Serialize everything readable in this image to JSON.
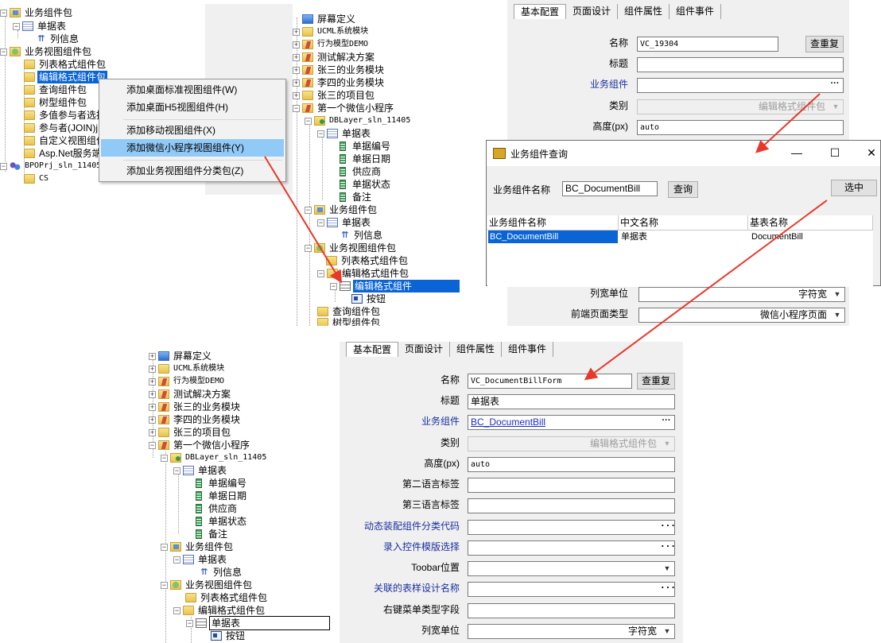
{
  "top_left_tree": {
    "items": [
      {
        "label": "业务组件包"
      },
      {
        "label": "单据表"
      },
      {
        "label": "列信息"
      },
      {
        "label": "业务视图组件包"
      },
      {
        "label": "列表格式组件包"
      },
      {
        "label": "编辑格式组件包"
      },
      {
        "label": "查询组件包"
      },
      {
        "label": "树型组件包"
      },
      {
        "label": "多值参与者选择"
      },
      {
        "label": "参与者(JOIN)j"
      },
      {
        "label": "自定义视图组件"
      },
      {
        "label": "Asp.Net服务端"
      },
      {
        "label": "BPOPrj_sln_11405"
      },
      {
        "label": "CS"
      }
    ]
  },
  "context_menu": {
    "items": [
      {
        "label": "添加桌面标准视图组件(W)"
      },
      {
        "label": "添加桌面H5视图组件(H)"
      },
      {
        "label": "添加移动视图组件(X)"
      },
      {
        "label": "添加微信小程序视图组件(Y)"
      },
      {
        "label": "添加业务视图组件分类包(Z)"
      }
    ]
  },
  "top_mid_tree": {
    "items": [
      {
        "label": "屏幕定义"
      },
      {
        "label": "UCML系统模块"
      },
      {
        "label": "行为模型DEMO"
      },
      {
        "label": "测试解决方案"
      },
      {
        "label": "张三的业务模块"
      },
      {
        "label": "李四的业务模块"
      },
      {
        "label": "张三的项目包"
      },
      {
        "label": "第一个微信小程序"
      },
      {
        "label": "DBLayer_sln_11405"
      },
      {
        "label": "单据表"
      },
      {
        "label": "单据编号"
      },
      {
        "label": "单据日期"
      },
      {
        "label": "供应商"
      },
      {
        "label": "单据状态"
      },
      {
        "label": "备注"
      },
      {
        "label": "业务组件包"
      },
      {
        "label": "单据表"
      },
      {
        "label": "列信息"
      },
      {
        "label": "业务视图组件包"
      },
      {
        "label": "列表格式组件包"
      },
      {
        "label": "编辑格式组件包"
      },
      {
        "label": "编辑格式组件"
      },
      {
        "label": "按钮"
      },
      {
        "label": "查询组件包"
      },
      {
        "label": "树型组件包"
      }
    ]
  },
  "top_props": {
    "tabs": [
      "基本配置",
      "页面设计",
      "组件属性",
      "组件事件"
    ],
    "name_label": "名称",
    "name_value": "VC_19304",
    "check_button": "查重复",
    "title_label": "标题",
    "title_value": "",
    "bc_label": "业务组件",
    "bc_value": "",
    "category_label": "类别",
    "category_value": "编辑格式组件包",
    "height_label": "高度(px)",
    "height_value": "auto",
    "colwidth_label": "列宽单位",
    "colwidth_value": "字符宽",
    "frontend_label": "前端页面类型",
    "frontend_value": "微信小程序页面"
  },
  "dialog": {
    "title": "业务组件查询",
    "search_label": "业务组件名称",
    "search_value": "BC_DocumentBill",
    "query_button": "查询",
    "select_button": "选中",
    "columns": [
      "业务组件名称",
      "中文名称",
      "基表名称"
    ],
    "rows": [
      [
        "BC_DocumentBill",
        "单据表",
        "DocumentBill"
      ]
    ]
  },
  "bottom_tree": {
    "items": [
      {
        "label": "屏幕定义"
      },
      {
        "label": "UCML系统模块"
      },
      {
        "label": "行为模型DEMO"
      },
      {
        "label": "测试解决方案"
      },
      {
        "label": "张三的业务模块"
      },
      {
        "label": "李四的业务模块"
      },
      {
        "label": "张三的项目包"
      },
      {
        "label": "第一个微信小程序"
      },
      {
        "label": "DBLayer_sln_11405"
      },
      {
        "label": "单据表"
      },
      {
        "label": "单据编号"
      },
      {
        "label": "单据日期"
      },
      {
        "label": "供应商"
      },
      {
        "label": "单据状态"
      },
      {
        "label": "备注"
      },
      {
        "label": "业务组件包"
      },
      {
        "label": "单据表"
      },
      {
        "label": "列信息"
      },
      {
        "label": "业务视图组件包"
      },
      {
        "label": "列表格式组件包"
      },
      {
        "label": "编辑格式组件包"
      },
      {
        "label": "单据表"
      },
      {
        "label": "按钮"
      }
    ]
  },
  "bottom_props": {
    "tabs": [
      "基本配置",
      "页面设计",
      "组件属性",
      "组件事件"
    ],
    "rows": [
      {
        "label": "名称",
        "value": "VC_DocumentBillForm"
      },
      {
        "label": "标题",
        "value": "单据表"
      },
      {
        "label": "业务组件",
        "value": "BC_DocumentBill"
      },
      {
        "label": "类别",
        "value": "编辑格式组件包"
      },
      {
        "label": "高度(px)",
        "value": "auto"
      },
      {
        "label": "第二语言标签",
        "value": ""
      },
      {
        "label": "第三语言标签",
        "value": ""
      },
      {
        "label": "动态装配组件分类代码",
        "value": ""
      },
      {
        "label": "录入控件模版选择",
        "value": ""
      },
      {
        "label": "Toobar位置",
        "value": ""
      },
      {
        "label": "关联的表样设计名称",
        "value": ""
      },
      {
        "label": "右键菜单类型字段",
        "value": ""
      },
      {
        "label": "列宽单位",
        "value": "字符宽"
      }
    ],
    "check_button": "查重复"
  },
  "colors": {
    "selection": "#0a64d6",
    "menu_highlight": "#91c9f7",
    "arrow": "#e8382a",
    "link_label": "#1a2f9e"
  }
}
